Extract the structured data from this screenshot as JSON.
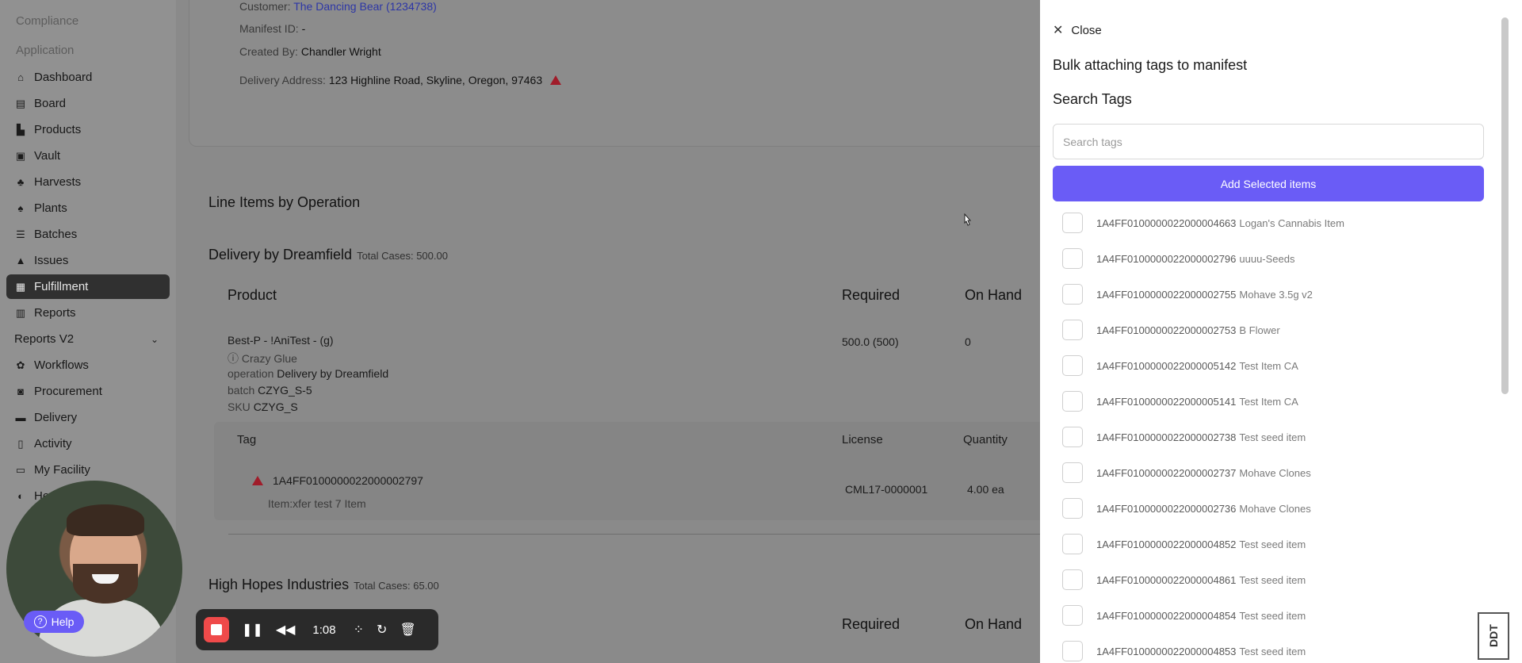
{
  "sidebar": {
    "sections": [
      "Compliance",
      "Application"
    ],
    "items": [
      {
        "label": "Dashboard",
        "icon": "home-icon"
      },
      {
        "label": "Board",
        "icon": "board-icon"
      },
      {
        "label": "Products",
        "icon": "products-icon"
      },
      {
        "label": "Vault",
        "icon": "vault-icon"
      },
      {
        "label": "Harvests",
        "icon": "harvest-icon"
      },
      {
        "label": "Plants",
        "icon": "plant-icon"
      },
      {
        "label": "Batches",
        "icon": "batches-icon"
      },
      {
        "label": "Issues",
        "icon": "warning-icon"
      },
      {
        "label": "Fulfillment",
        "icon": "fulfillment-icon",
        "active": true
      },
      {
        "label": "Reports",
        "icon": "chart-icon"
      },
      {
        "label": "Reports V2",
        "icon": "chevron-down-icon"
      },
      {
        "label": "Workflows",
        "icon": "workflow-icon"
      },
      {
        "label": "Procurement",
        "icon": "bag-icon"
      },
      {
        "label": "Delivery",
        "icon": "truck-icon"
      },
      {
        "label": "Activity",
        "icon": "activity-icon"
      },
      {
        "label": "My Facility",
        "icon": "facility-icon"
      },
      {
        "label": "He",
        "icon": "headset-icon"
      }
    ]
  },
  "manifest": {
    "customer_label": "Customer:",
    "customer_value": "The Dancing Bear (1234738)",
    "manifest_label": "Manifest ID:",
    "manifest_value": "-",
    "created_label": "Created By:",
    "created_value": "Chandler Wright",
    "address_label": "Delivery Address:",
    "address_value": "123 Highline Road, Skyline, Oregon, 97463"
  },
  "line_items": {
    "heading": "Line Items by Operation",
    "group1": {
      "title": "Delivery by Dreamfield",
      "cases": "Total Cases: 500.00",
      "col_product": "Product",
      "col_required": "Required",
      "col_onhand": "On Hand",
      "product_name": "Best-P - !AniTest - (g)",
      "product_strain": "Crazy Glue",
      "op_label": "operation",
      "op_value": "Delivery by Dreamfield",
      "batch_label": "batch",
      "batch_value": "CZYG_S-5",
      "sku_label": "SKU",
      "sku_value": "CZYG_S",
      "required": "500.0 (500)",
      "on_hand": "0",
      "col_tag": "Tag",
      "col_license": "License",
      "col_quantity": "Quantity",
      "tag_id": "1A4FF0100000022000002797",
      "tag_item": "Item:xfer test 7 Item",
      "license": "CML17-0000001",
      "quantity": "4.00 ea"
    },
    "group2": {
      "title": "High Hopes Industries",
      "cases": "Total Cases: 65.00",
      "col_required": "Required",
      "col_onhand": "On Hand"
    }
  },
  "drawer": {
    "close_label": "Close",
    "title": "Bulk attaching tags to manifest",
    "search_heading": "Search Tags",
    "search_placeholder": "Search tags",
    "add_button": "Add Selected items",
    "tags": [
      {
        "id": "1A4FF0100000022000004663",
        "name": "Logan's Cannabis Item"
      },
      {
        "id": "1A4FF0100000022000002796",
        "name": "uuuu-Seeds"
      },
      {
        "id": "1A4FF0100000022000002755",
        "name": "Mohave 3.5g v2"
      },
      {
        "id": "1A4FF0100000022000002753",
        "name": "B Flower"
      },
      {
        "id": "1A4FF0100000022000005142",
        "name": "Test Item CA"
      },
      {
        "id": "1A4FF0100000022000005141",
        "name": "Test Item CA"
      },
      {
        "id": "1A4FF0100000022000002738",
        "name": "Test seed item"
      },
      {
        "id": "1A4FF0100000022000002737",
        "name": "Mohave Clones"
      },
      {
        "id": "1A4FF0100000022000002736",
        "name": "Mohave Clones"
      },
      {
        "id": "1A4FF0100000022000004852",
        "name": "Test seed item"
      },
      {
        "id": "1A4FF0100000022000004861",
        "name": "Test seed item"
      },
      {
        "id": "1A4FF0100000022000004854",
        "name": "Test seed item"
      },
      {
        "id": "1A4FF0100000022000004853",
        "name": "Test seed item"
      }
    ]
  },
  "widget": {
    "help_label": "Help",
    "recorder_time": "1:08",
    "ddt_label": "DDT"
  },
  "colors": {
    "accent": "#6a5cf6",
    "warning": "#a01c2a",
    "record": "#ef4a4a"
  }
}
